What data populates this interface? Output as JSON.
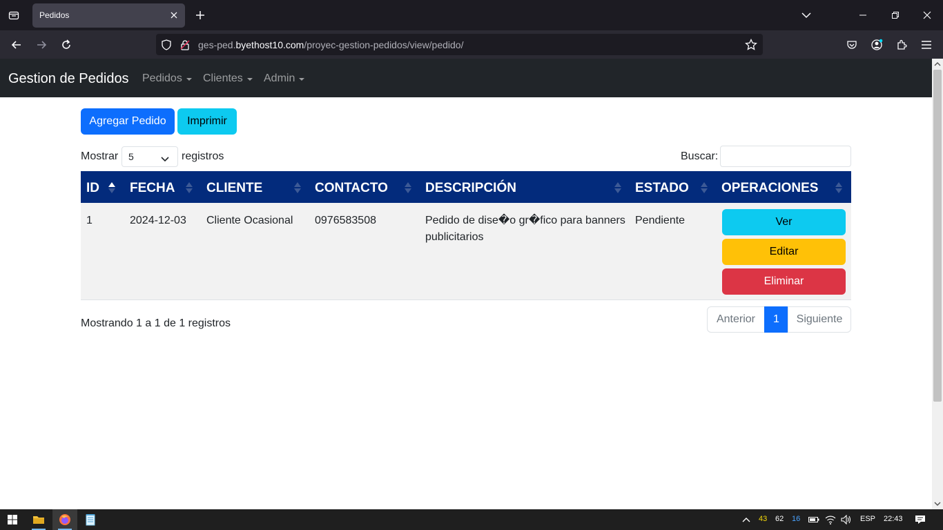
{
  "browser": {
    "tab_title": "Pedidos",
    "url_prefix": "ges-ped.",
    "url_domain": "byethost10.com",
    "url_path": "/proyec-gestion-pedidos/view/pedido/"
  },
  "app": {
    "brand": "Gestion de Pedidos",
    "menu": [
      {
        "label": "Pedidos"
      },
      {
        "label": "Clientes"
      },
      {
        "label": "Admin"
      }
    ]
  },
  "toolbar": {
    "add_label": "Agregar Pedido",
    "print_label": "Imprimir"
  },
  "table_controls": {
    "show_label": "Mostrar",
    "show_value": "5",
    "records_label": "registros",
    "search_label": "Buscar:",
    "search_value": ""
  },
  "table": {
    "headers": [
      "ID",
      "FECHA",
      "CLIENTE",
      "CONTACTO",
      "DESCRIPCIÓN",
      "ESTADO",
      "OPERACIONES"
    ],
    "rows": [
      {
        "id": "1",
        "fecha": "2024-12-03",
        "cliente": "Cliente Ocasional",
        "contacto": "0976583508",
        "descripcion_line1": "Pedido de dise�o gr�fico para banners",
        "descripcion_line2": "publicitarios",
        "estado": "Pendiente",
        "actions": {
          "view": "Ver",
          "edit": "Editar",
          "delete": "Eliminar"
        }
      }
    ]
  },
  "footer": {
    "info": "Mostrando 1 a 1 de 1 registros",
    "prev": "Anterior",
    "page": "1",
    "next": "Siguiente"
  },
  "taskbar": {
    "tray_values": [
      "43",
      "62",
      "16"
    ],
    "lang": "ESP",
    "time": "22:43"
  },
  "colors": {
    "primary": "#0d6efd",
    "info": "#0dcaf0",
    "warning": "#ffc107",
    "danger": "#dc3545",
    "table_header": "#032b7c",
    "navbar": "#212529"
  }
}
